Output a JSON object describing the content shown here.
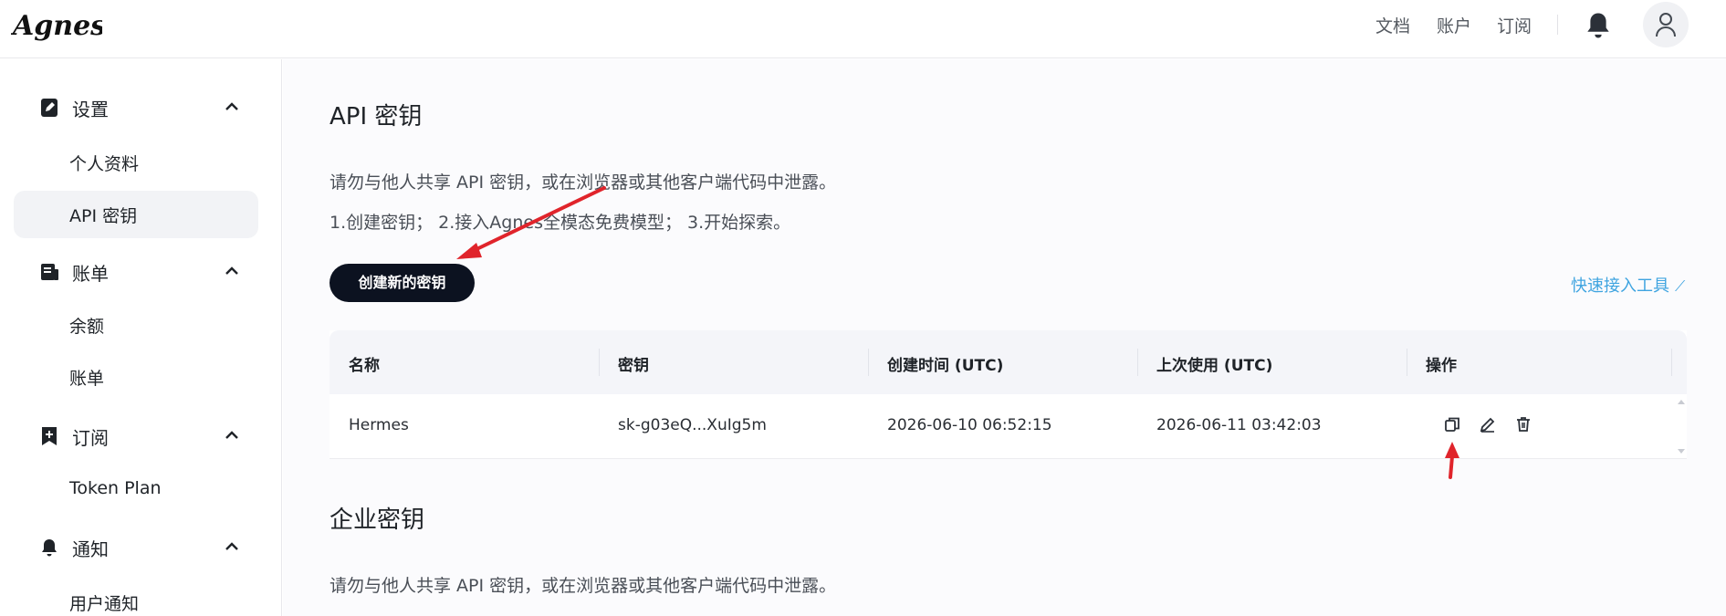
{
  "header": {
    "logo_text": "Agnes",
    "nav": [
      "文档",
      "账户",
      "订阅"
    ]
  },
  "sidebar": {
    "groups": [
      {
        "label": "设置",
        "icon": "edit-square-icon",
        "items": [
          "个人资料",
          "API 密钥"
        ]
      },
      {
        "label": "账单",
        "icon": "receipt-icon",
        "items": [
          "余额",
          "账单"
        ]
      },
      {
        "label": "订阅",
        "icon": "bookmark-plus-icon",
        "items": [
          "Token Plan"
        ]
      },
      {
        "label": "通知",
        "icon": "bell-icon",
        "items": [
          "用户通知"
        ]
      }
    ],
    "active_item": "API 密钥"
  },
  "main": {
    "api_section": {
      "title": "API 密钥",
      "warning": "请勿与他人共享 API 密钥，或在浏览器或其他客户端代码中泄露。",
      "steps": "1.创建密钥；  2.接入Agnes全模态免费模型；  3.开始探索。",
      "create_button": "创建新的密钥",
      "quick_link": "快速接入工具",
      "table": {
        "headers": [
          "名称",
          "密钥",
          "创建时间 (UTC)",
          "上次使用 (UTC)",
          "操作"
        ],
        "rows": [
          {
            "name": "Hermes",
            "key": "sk-g03eQ...XuIg5m",
            "created": "2026-06-10 06:52:15",
            "last_used": "2026-06-11 03:42:03"
          }
        ]
      }
    },
    "enterprise_section": {
      "title": "企业密钥",
      "warning": "请勿与他人共享 API 密钥，或在浏览器或其他客户端代码中泄露。"
    }
  },
  "colors": {
    "accent_link": "#3fa4e0",
    "primary_button": "#0c1220",
    "annotation_arrow": "#e0242b"
  }
}
